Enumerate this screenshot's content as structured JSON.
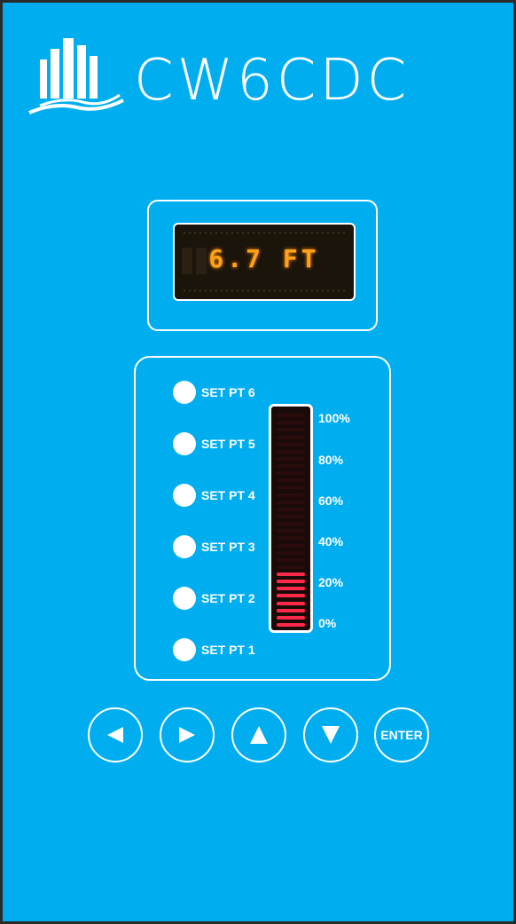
{
  "brand": {
    "name": "CW6CDC",
    "logo_icon": "city-buildings-wave-icon"
  },
  "display": {
    "reading": "6.7 FT",
    "color": "#ffa21a"
  },
  "setpoints": [
    {
      "label": "SET PT 6"
    },
    {
      "label": "SET PT 5"
    },
    {
      "label": "SET PT 4"
    },
    {
      "label": "SET PT 3"
    },
    {
      "label": "SET PT 2"
    },
    {
      "label": "SET PT 1"
    }
  ],
  "bargraph": {
    "level_percent": 25,
    "lit_color": "#ff2a4a",
    "unlit_color": "#2a0c0c",
    "scale": [
      "100%",
      "80%",
      "60%",
      "40%",
      "20%",
      "0%"
    ]
  },
  "buttons": {
    "left_icon": "left-arrow-icon",
    "right_icon": "right-arrow-icon",
    "up_icon": "up-arrow-icon",
    "down_icon": "down-arrow-icon",
    "enter_label": "ENTER"
  },
  "colors": {
    "panel": "#00aeef",
    "frame": "#ffffff"
  }
}
